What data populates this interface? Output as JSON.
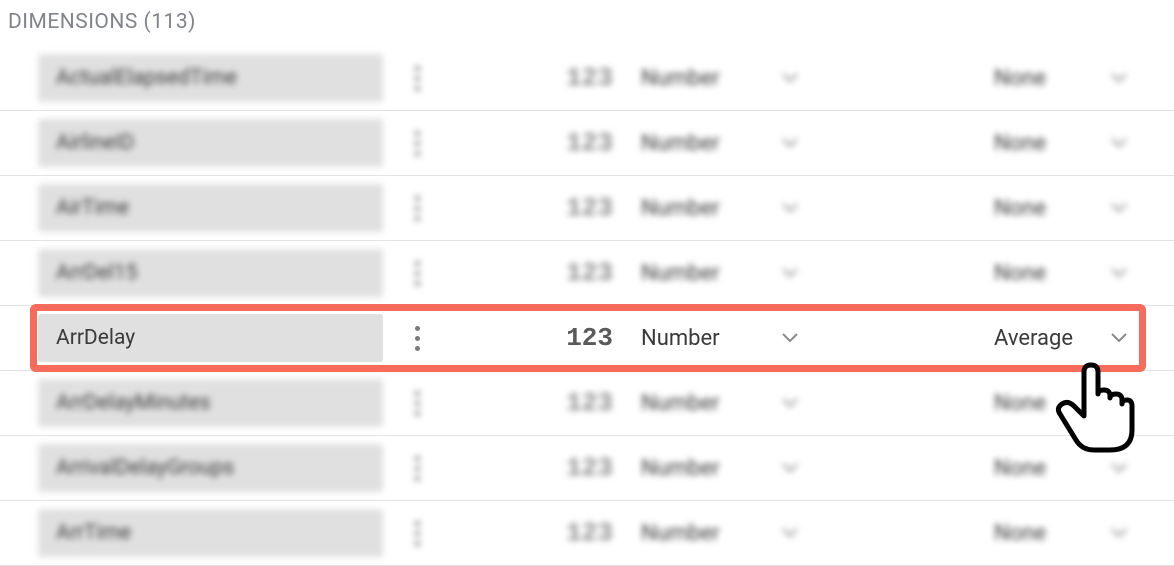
{
  "header": {
    "title_prefix": "DIMENSIONS",
    "count": "113"
  },
  "rows": [
    {
      "name": "ActualElapsedTime",
      "badge": "123",
      "type": "Number",
      "agg": "None",
      "selected": false
    },
    {
      "name": "AirlineID",
      "badge": "123",
      "type": "Number",
      "agg": "None",
      "selected": false
    },
    {
      "name": "AirTime",
      "badge": "123",
      "type": "Number",
      "agg": "None",
      "selected": false
    },
    {
      "name": "ArrDel15",
      "badge": "123",
      "type": "Number",
      "agg": "None",
      "selected": false
    },
    {
      "name": "ArrDelay",
      "badge": "123",
      "type": "Number",
      "agg": "Average",
      "selected": true
    },
    {
      "name": "ArrDelayMinutes",
      "badge": "123",
      "type": "Number",
      "agg": "None",
      "selected": false
    },
    {
      "name": "ArrivalDelayGroups",
      "badge": "123",
      "type": "Number",
      "agg": "None",
      "selected": false
    },
    {
      "name": "ArrTime",
      "badge": "123",
      "type": "Number",
      "agg": "None",
      "selected": false
    }
  ]
}
